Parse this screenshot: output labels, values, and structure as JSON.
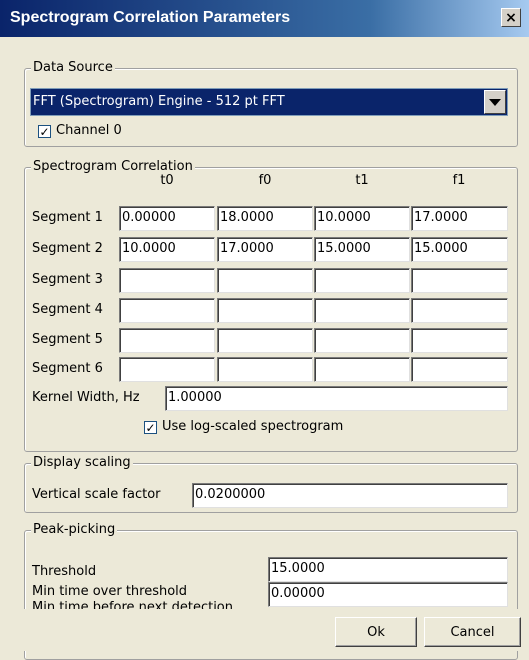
{
  "window": {
    "title": "Spectrogram Correlation Parameters",
    "close_glyph": "×"
  },
  "data_source": {
    "group_title": "Data Source",
    "engine_selected": "FFT (Spectrogram) Engine - 512 pt FFT",
    "channel_label": "Channel 0",
    "channel_checked": true
  },
  "correlation": {
    "group_title": "Spectrogram Correlation",
    "columns": [
      "t0",
      "f0",
      "t1",
      "f1"
    ],
    "segments": [
      {
        "label": "Segment 1",
        "values": [
          "0.00000",
          "18.0000",
          "10.0000",
          "17.0000"
        ]
      },
      {
        "label": "Segment 2",
        "values": [
          "10.0000",
          "17.0000",
          "15.0000",
          "15.0000"
        ]
      },
      {
        "label": "Segment 3",
        "values": [
          "",
          "",
          "",
          ""
        ]
      },
      {
        "label": "Segment 4",
        "values": [
          "",
          "",
          "",
          ""
        ]
      },
      {
        "label": "Segment 5",
        "values": [
          "",
          "",
          "",
          ""
        ]
      },
      {
        "label": "Segment 6",
        "values": [
          "",
          "",
          "",
          ""
        ]
      }
    ],
    "kernel_label": "Kernel Width, Hz",
    "kernel_value": "1.00000",
    "log_scaled_label": "Use log-scaled spectrogram",
    "log_scaled_checked": true
  },
  "display_scaling": {
    "group_title": "Display scaling",
    "vertical_label": "Vertical scale factor",
    "vertical_value": "0.0200000"
  },
  "peak_picking": {
    "group_title": "Peak-picking",
    "threshold_label": "Threshold",
    "threshold_value": "15.0000",
    "min_time_label": "Min time over threshold",
    "min_time_value": "0.00000",
    "clipped_label": "Min time before next detection"
  },
  "buttons": {
    "ok": "Ok",
    "cancel": "Cancel"
  },
  "check_glyph": "✓"
}
